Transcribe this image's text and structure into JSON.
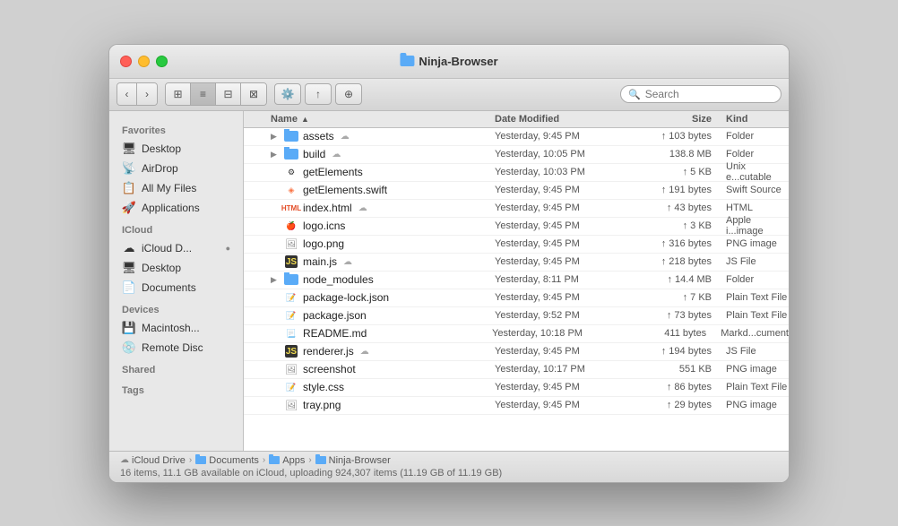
{
  "window": {
    "title": "Ninja-Browser"
  },
  "toolbar": {
    "search_placeholder": "Search"
  },
  "sidebar": {
    "favorites_label": "Favorites",
    "icloud_label": "iCloud",
    "devices_label": "Devices",
    "shared_label": "Shared",
    "tags_label": "Tags",
    "items": [
      {
        "id": "desktop",
        "label": "Desktop",
        "icon": "🖥"
      },
      {
        "id": "airdrop",
        "label": "AirDrop",
        "icon": "📡"
      },
      {
        "id": "all-my-files",
        "label": "All My Files",
        "icon": "📋"
      },
      {
        "id": "applications",
        "label": "Applications",
        "icon": "🚀"
      },
      {
        "id": "icloud-drive",
        "label": "iCloud D...",
        "icon": "☁"
      },
      {
        "id": "icloud-desktop",
        "label": "Desktop",
        "icon": "🖥"
      },
      {
        "id": "documents",
        "label": "Documents",
        "icon": "📄"
      },
      {
        "id": "macintosh",
        "label": "Macintosh...",
        "icon": "💾"
      },
      {
        "id": "remote-disc",
        "label": "Remote Disc",
        "icon": "💿"
      }
    ]
  },
  "columns": {
    "name": "Name",
    "date_modified": "Date Modified",
    "size": "Size",
    "kind": "Kind"
  },
  "files": [
    {
      "name": "assets",
      "type": "folder",
      "has_arrow": true,
      "cloud": true,
      "date": "Yesterday, 9:45 PM",
      "size": "↑ 103 bytes",
      "kind": "Folder"
    },
    {
      "name": "build",
      "type": "folder",
      "has_arrow": true,
      "cloud": true,
      "date": "Yesterday, 10:05 PM",
      "size": "138.8 MB",
      "kind": "Folder"
    },
    {
      "name": "getElements",
      "type": "exec",
      "has_arrow": false,
      "cloud": false,
      "date": "Yesterday, 10:03 PM",
      "size": "↑ 5 KB",
      "kind": "Unix e...cutable"
    },
    {
      "name": "getElements.swift",
      "type": "swift",
      "has_arrow": false,
      "cloud": false,
      "date": "Yesterday, 9:45 PM",
      "size": "↑ 191 bytes",
      "kind": "Swift Source"
    },
    {
      "name": "index.html",
      "type": "html",
      "has_arrow": false,
      "cloud": true,
      "date": "Yesterday, 9:45 PM",
      "size": "↑ 43 bytes",
      "kind": "HTML"
    },
    {
      "name": "logo.icns",
      "type": "icns",
      "has_arrow": false,
      "cloud": false,
      "date": "Yesterday, 9:45 PM",
      "size": "↑ 3 KB",
      "kind": "Apple i...image"
    },
    {
      "name": "logo.png",
      "type": "img",
      "has_arrow": false,
      "cloud": false,
      "date": "Yesterday, 9:45 PM",
      "size": "↑ 316 bytes",
      "kind": "PNG image"
    },
    {
      "name": "main.js",
      "type": "js",
      "has_arrow": false,
      "cloud": true,
      "date": "Yesterday, 9:45 PM",
      "size": "↑ 218 bytes",
      "kind": "JS File"
    },
    {
      "name": "node_modules",
      "type": "folder",
      "has_arrow": true,
      "cloud": false,
      "date": "Yesterday, 8:11 PM",
      "size": "↑ 14.4 MB",
      "kind": "Folder"
    },
    {
      "name": "package-lock.json",
      "type": "txt",
      "has_arrow": false,
      "cloud": false,
      "date": "Yesterday, 9:45 PM",
      "size": "↑ 7 KB",
      "kind": "Plain Text File"
    },
    {
      "name": "package.json",
      "type": "txt",
      "has_arrow": false,
      "cloud": false,
      "date": "Yesterday, 9:52 PM",
      "size": "↑ 73 bytes",
      "kind": "Plain Text File"
    },
    {
      "name": "README.md",
      "type": "md",
      "has_arrow": false,
      "cloud": false,
      "date": "Yesterday, 10:18 PM",
      "size": "411 bytes",
      "kind": "Markd...cument"
    },
    {
      "name": "renderer.js",
      "type": "js",
      "has_arrow": false,
      "cloud": true,
      "date": "Yesterday, 9:45 PM",
      "size": "↑ 194 bytes",
      "kind": "JS File"
    },
    {
      "name": "screenshot",
      "type": "img",
      "has_arrow": false,
      "cloud": false,
      "date": "Yesterday, 10:17 PM",
      "size": "551 KB",
      "kind": "PNG image"
    },
    {
      "name": "style.css",
      "type": "txt",
      "has_arrow": false,
      "cloud": false,
      "date": "Yesterday, 9:45 PM",
      "size": "↑ 86 bytes",
      "kind": "Plain Text File"
    },
    {
      "name": "tray.png",
      "type": "img",
      "has_arrow": false,
      "cloud": false,
      "date": "Yesterday, 9:45 PM",
      "size": "↑ 29 bytes",
      "kind": "PNG image"
    }
  ],
  "breadcrumb": [
    {
      "label": "iCloud Drive",
      "icon": "cloud"
    },
    {
      "label": "Documents",
      "icon": "folder"
    },
    {
      "label": "Apps",
      "icon": "folder"
    },
    {
      "label": "Ninja-Browser",
      "icon": "folder"
    }
  ],
  "status": "16 items, 11.1 GB available on iCloud, uploading 924,307 items (11.19 GB of 11.19 GB)"
}
